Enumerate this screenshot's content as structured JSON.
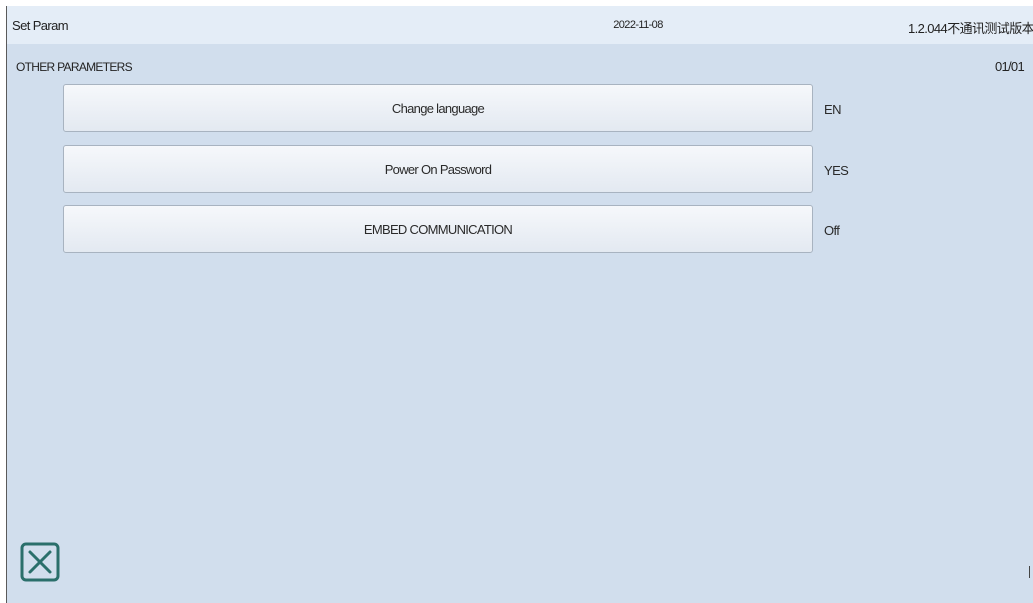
{
  "header": {
    "title": "Set Param",
    "date": "2022-11-08",
    "version": "1.2.044不通讯测试版本"
  },
  "section": {
    "label": "OTHER PARAMETERS",
    "page": "01/01"
  },
  "params": [
    {
      "label": "Change language",
      "value": "EN"
    },
    {
      "label": "Power On Password",
      "value": "YES"
    },
    {
      "label": "EMBED COMMUNICATION",
      "value": "Off"
    }
  ],
  "colors": {
    "background": "#d1deed",
    "titlebar": "#e4edf7",
    "close_icon": "#2a6f6b"
  },
  "icons": {
    "close": "close-icon"
  }
}
